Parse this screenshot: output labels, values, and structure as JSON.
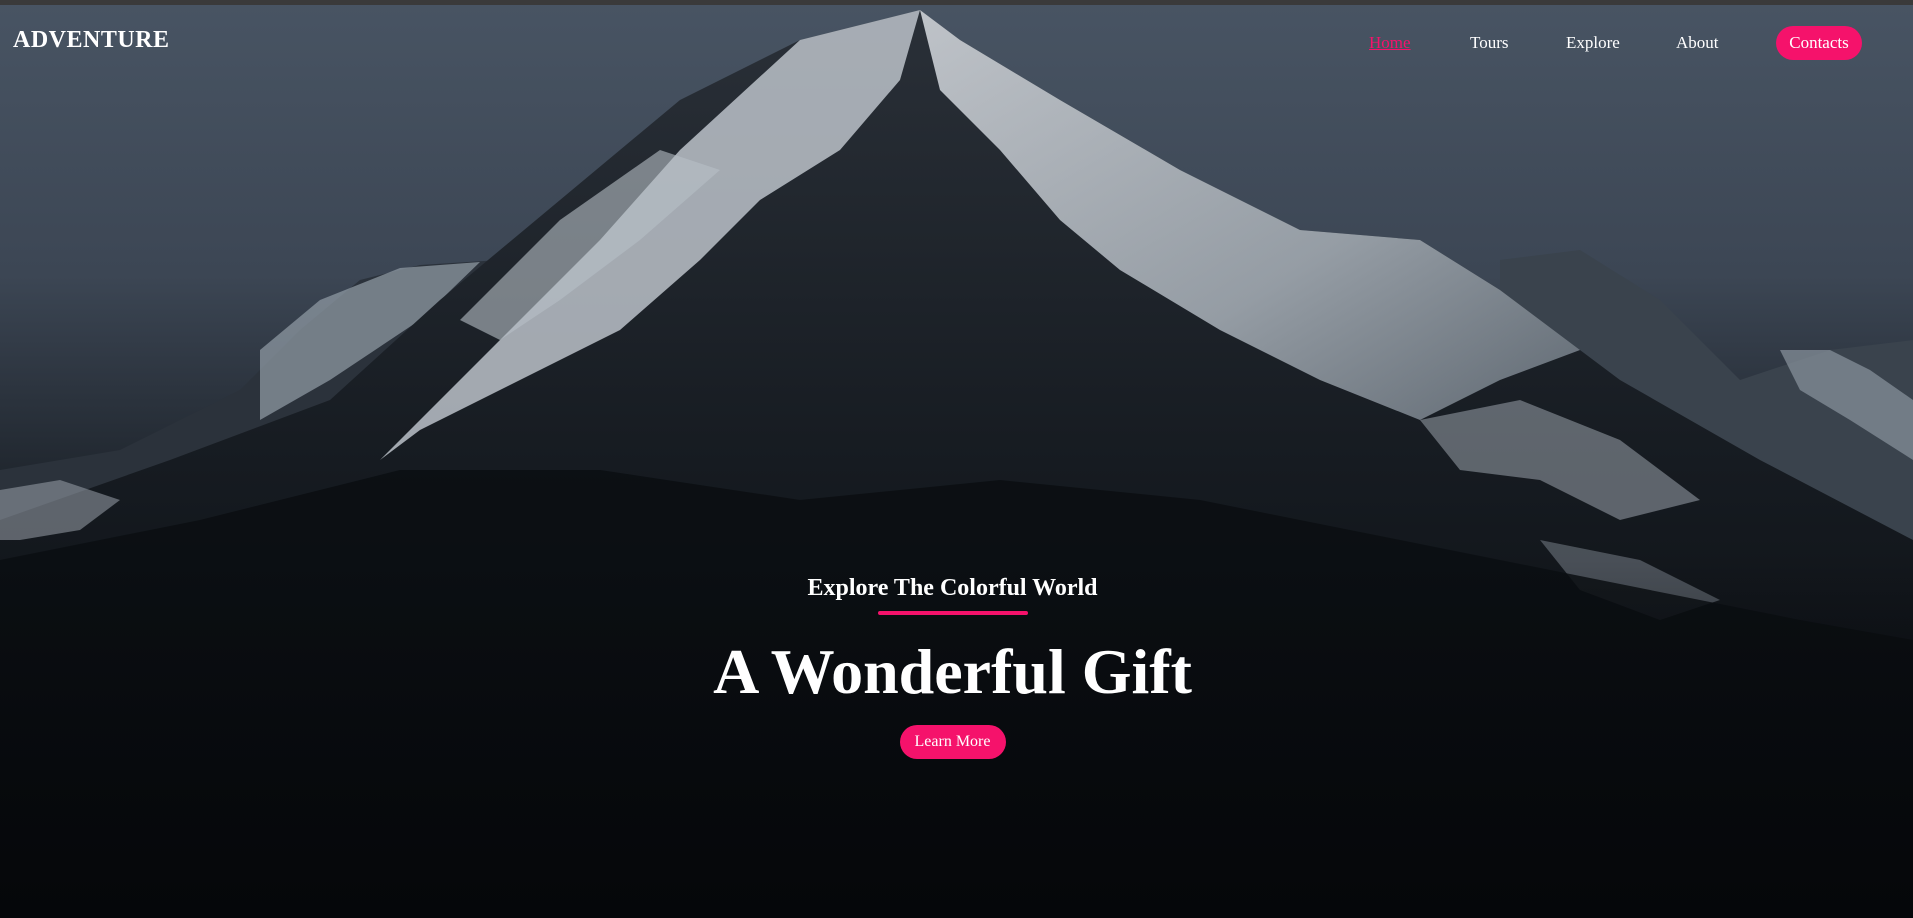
{
  "brand": {
    "name": "ADVENTURE"
  },
  "nav": {
    "items": [
      {
        "label": "Home",
        "active": true
      },
      {
        "label": "Tours",
        "active": false
      },
      {
        "label": "Explore",
        "active": false
      },
      {
        "label": "About",
        "active": false
      }
    ],
    "contacts_label": "Contacts"
  },
  "hero": {
    "subtitle": "Explore The Colorful World",
    "title": "A Wonderful Gift",
    "button_label": "Learn More"
  },
  "colors": {
    "accent": "#f5126b",
    "text": "#ffffff",
    "sky": "#485463",
    "ground": "#05070a"
  }
}
